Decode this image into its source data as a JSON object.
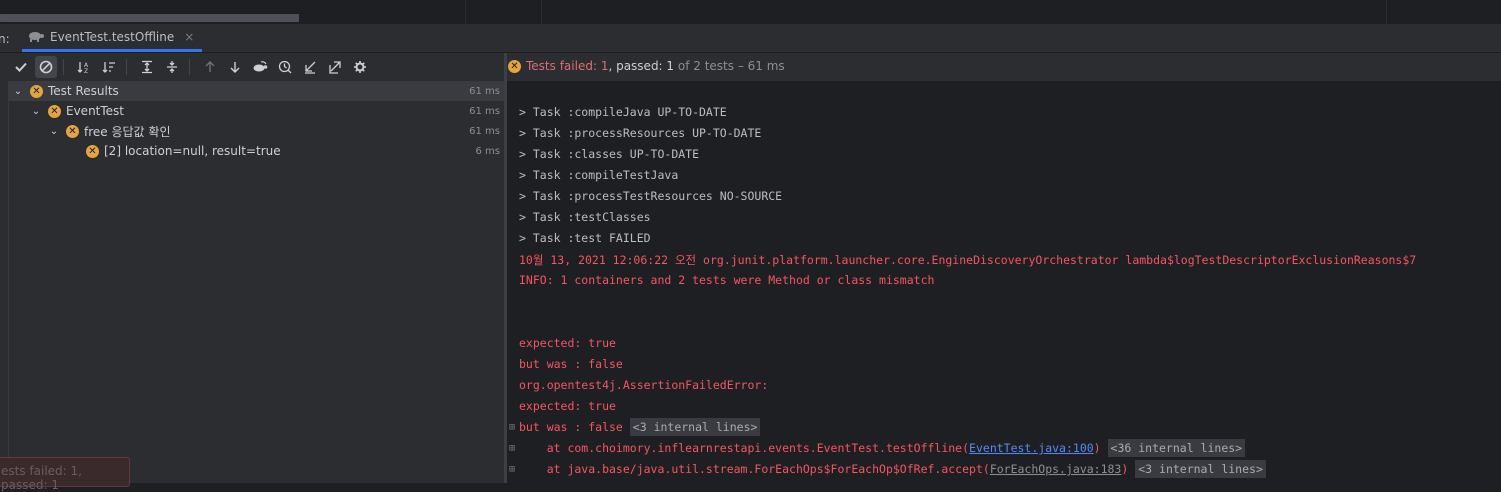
{
  "tab": {
    "run_label": "n:",
    "title": "EventTest.testOffline",
    "close": "×"
  },
  "toolbar": {
    "icons": [
      "check-icon",
      "stop-circle-icon",
      "sort-alpha-icon",
      "sort-duration-icon",
      "expand-all-icon",
      "collapse-all-icon",
      "arrow-up-icon",
      "arrow-down-icon",
      "rerun-turtle-icon",
      "history-clock-icon",
      "import-icon",
      "export-icon",
      "settings-gear-icon"
    ]
  },
  "status": {
    "failed_label": "Tests failed: ",
    "failed_count": "1",
    "passed_label": ", passed: ",
    "passed_count": "1",
    "rest": " of 2 tests – 61 ms"
  },
  "tree": [
    {
      "label": "Test Results",
      "time": "61 ms"
    },
    {
      "label": "EventTest",
      "time": "61 ms"
    },
    {
      "label": "free 응답값 확인",
      "time": "61 ms"
    },
    {
      "label": "[2] location=null, result=true",
      "time": "6 ms"
    }
  ],
  "console": {
    "lines": [
      "> Task :compileJava UP-TO-DATE",
      "> Task :processResources UP-TO-DATE",
      "> Task :classes UP-TO-DATE",
      "> Task :compileTestJava",
      "> Task :processTestResources NO-SOURCE",
      "> Task :testClasses",
      "> Task :test FAILED"
    ],
    "err_lines": [
      "10월 13, 2021 12:06:22 오전 org.junit.platform.launcher.core.EngineDiscoveryOrchestrator lambda$logTestDescriptorExclusionReasons$7",
      "INFO: 1 containers and 2 tests were Method or class mismatch",
      "expected: true",
      "but was : false",
      "org.opentest4j.AssertionFailedError:",
      "expected: true",
      "but was : false"
    ],
    "internal_3": "<3 internal lines>",
    "stack1_pre": "    at com.choimory.inflearnrestapi.events.EventTest.testOffline(",
    "stack1_link": "EventTest.java:100",
    "stack1_post": ")",
    "internal_36": "<36 internal lines>",
    "stack2_pre": "    at java.base/java.util.stream.ForEachOps$ForEachOp$OfRef.accept(",
    "stack2_link": "ForEachOps.java:183",
    "stack2_post": ")",
    "internal_3b": "<3 internal lines>",
    "fold_glyph": "⊞"
  },
  "toast": {
    "text": "ests failed: 1, passed: 1"
  },
  "colors": {
    "accent": "#3574f0",
    "error": "#f75464",
    "warning_icon": "#e5a53b"
  }
}
